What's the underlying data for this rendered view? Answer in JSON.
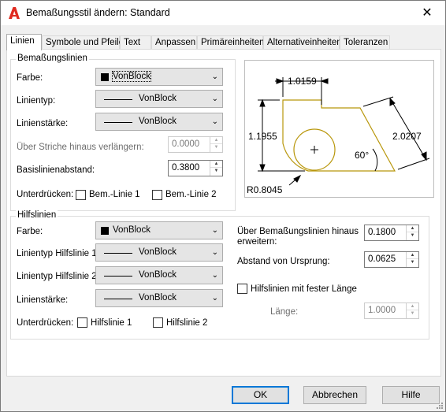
{
  "window": {
    "title": "Bemaßungsstil ändern: Standard",
    "close_glyph": "✕"
  },
  "tabs": [
    {
      "label": "Linien"
    },
    {
      "label": "Symbole und Pfeile"
    },
    {
      "label": "Text"
    },
    {
      "label": "Anpassen"
    },
    {
      "label": "Primäreinheiten"
    },
    {
      "label": "Alternativeinheiten"
    },
    {
      "label": "Toleranzen"
    }
  ],
  "dim_lines": {
    "group_title": "Bemaßungslinien",
    "color_label": "Farbe:",
    "color_value": "VonBlock",
    "linetype_label": "Linientyp:",
    "linetype_value": "VonBlock",
    "lineweight_label": "Linienstärke:",
    "lineweight_value": "VonBlock",
    "extend_label": "Über Striche hinaus verlängern:",
    "extend_value": "0.0000",
    "baseline_label": "Basislinienabstand:",
    "baseline_value": "0.3800",
    "suppress_label": "Unterdrücken:",
    "suppress_1": "Bem.-Linie 1",
    "suppress_2": "Bem.-Linie 2"
  },
  "ext_lines": {
    "group_title": "Hilfslinien",
    "color_label": "Farbe:",
    "color_value": "VonBlock",
    "linetype1_label": "Linientyp Hilfslinie 1:",
    "linetype1_value": "VonBlock",
    "linetype2_label": "Linientyp Hilfslinie 2:",
    "linetype2_value": "VonBlock",
    "lineweight_label": "Linienstärke:",
    "lineweight_value": "VonBlock",
    "suppress_label": "Unterdrücken:",
    "suppress_1": "Hilfslinie 1",
    "suppress_2": "Hilfslinie 2",
    "extend_beyond_label_1": "Über Bemaßungslinien hinaus",
    "extend_beyond_label_2": "erweitern:",
    "extend_beyond_value": "0.1800",
    "offset_label": "Abstand von Ursprung:",
    "offset_value": "0.0625",
    "fixed_length_label": "Hilfslinien mit fester Länge",
    "length_label": "Länge:",
    "length_value": "1.0000"
  },
  "preview": {
    "dim_top": "1.0159",
    "dim_left": "1.1955",
    "dim_right": "2.0207",
    "dim_angle": "60°",
    "dim_radius": "R0.8045"
  },
  "buttons": {
    "ok": "OK",
    "cancel": "Abbrechen",
    "help": "Hilfe"
  },
  "colors": {
    "accent": "#0078d7",
    "shape": "#b8960a",
    "app_icon": "#e02b20"
  }
}
